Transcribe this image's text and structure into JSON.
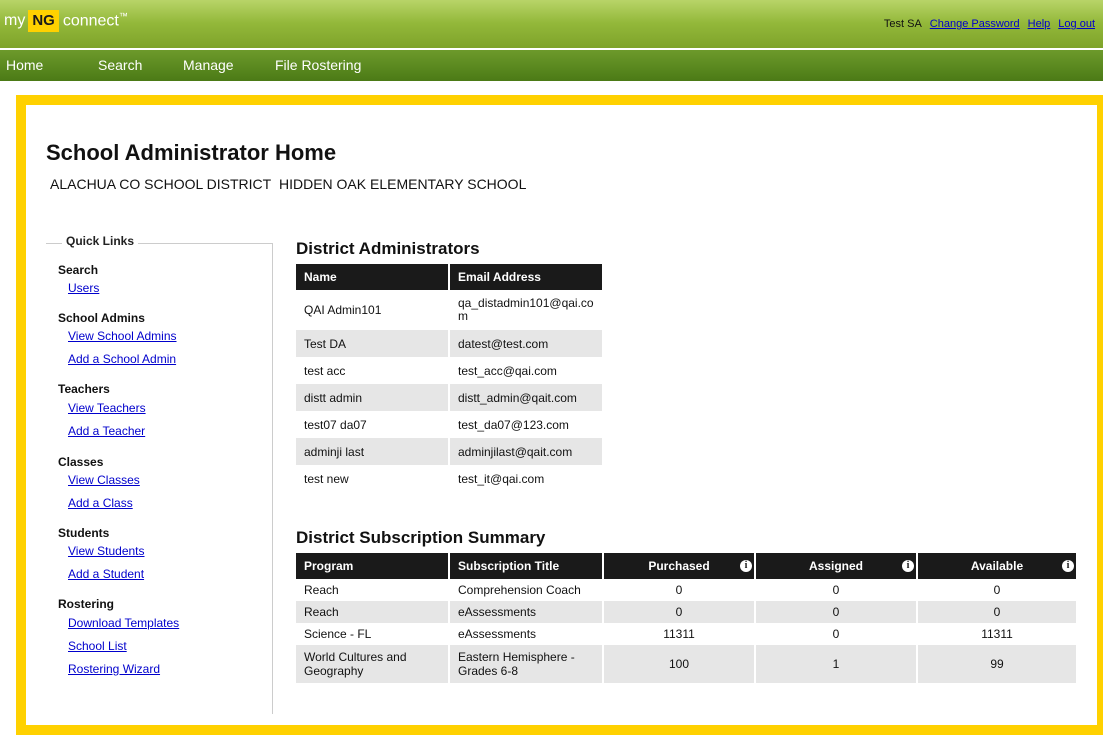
{
  "brand": {
    "my": "my",
    "ng": "NG",
    "connect": "connect",
    "tm": "™"
  },
  "user_nav": {
    "user": "Test SA",
    "change_password": "Change Password",
    "help": "Help",
    "logout": "Log out"
  },
  "menu": [
    "Home",
    "Search",
    "Manage",
    "File Rostering"
  ],
  "page": {
    "title": "School Administrator Home",
    "district": "ALACHUA CO SCHOOL DISTRICT",
    "school": "HIDDEN OAK ELEMENTARY SCHOOL"
  },
  "quick_links": {
    "legend": "Quick Links",
    "sections": [
      {
        "head": "Search",
        "links": [
          "Users"
        ]
      },
      {
        "head": "School Admins",
        "links": [
          "View School Admins",
          "Add a School Admin"
        ]
      },
      {
        "head": "Teachers",
        "links": [
          "View Teachers",
          "Add a Teacher"
        ]
      },
      {
        "head": "Classes",
        "links": [
          "View Classes",
          "Add a Class"
        ]
      },
      {
        "head": "Students",
        "links": [
          "View Students",
          "Add a Student"
        ]
      },
      {
        "head": "Rostering",
        "links": [
          "Download Templates",
          "School List",
          "Rostering Wizard"
        ]
      }
    ]
  },
  "district_admins": {
    "title": "District Administrators",
    "headers": [
      "Name",
      "Email Address"
    ],
    "rows": [
      [
        "QAI Admin101",
        "qa_distadmin101@qai.co\nm"
      ],
      [
        "Test DA",
        "datest@test.com"
      ],
      [
        "test acc",
        "test_acc@qai.com"
      ],
      [
        "distt admin",
        "distt_admin@qait.com"
      ],
      [
        "test07 da07",
        "test_da07@123.com"
      ],
      [
        "adminji last",
        "adminjilast@qait.com"
      ],
      [
        "test new",
        "test_it@qai.com"
      ]
    ]
  },
  "subscriptions": {
    "title": "District Subscription Summary",
    "headers": [
      "Program",
      "Subscription Title",
      "Purchased",
      "Assigned",
      "Available"
    ],
    "info_icon": "i",
    "rows": [
      [
        "Reach",
        "Comprehension Coach",
        "0",
        "0",
        "0"
      ],
      [
        "Reach",
        "eAssessments",
        "0",
        "0",
        "0"
      ],
      [
        "Science - FL",
        "eAssessments",
        "11311",
        "0",
        "11311"
      ],
      [
        "World Cultures and Geography",
        "Eastern Hemisphere - Grades 6-8",
        "100",
        "1",
        "99"
      ]
    ]
  }
}
